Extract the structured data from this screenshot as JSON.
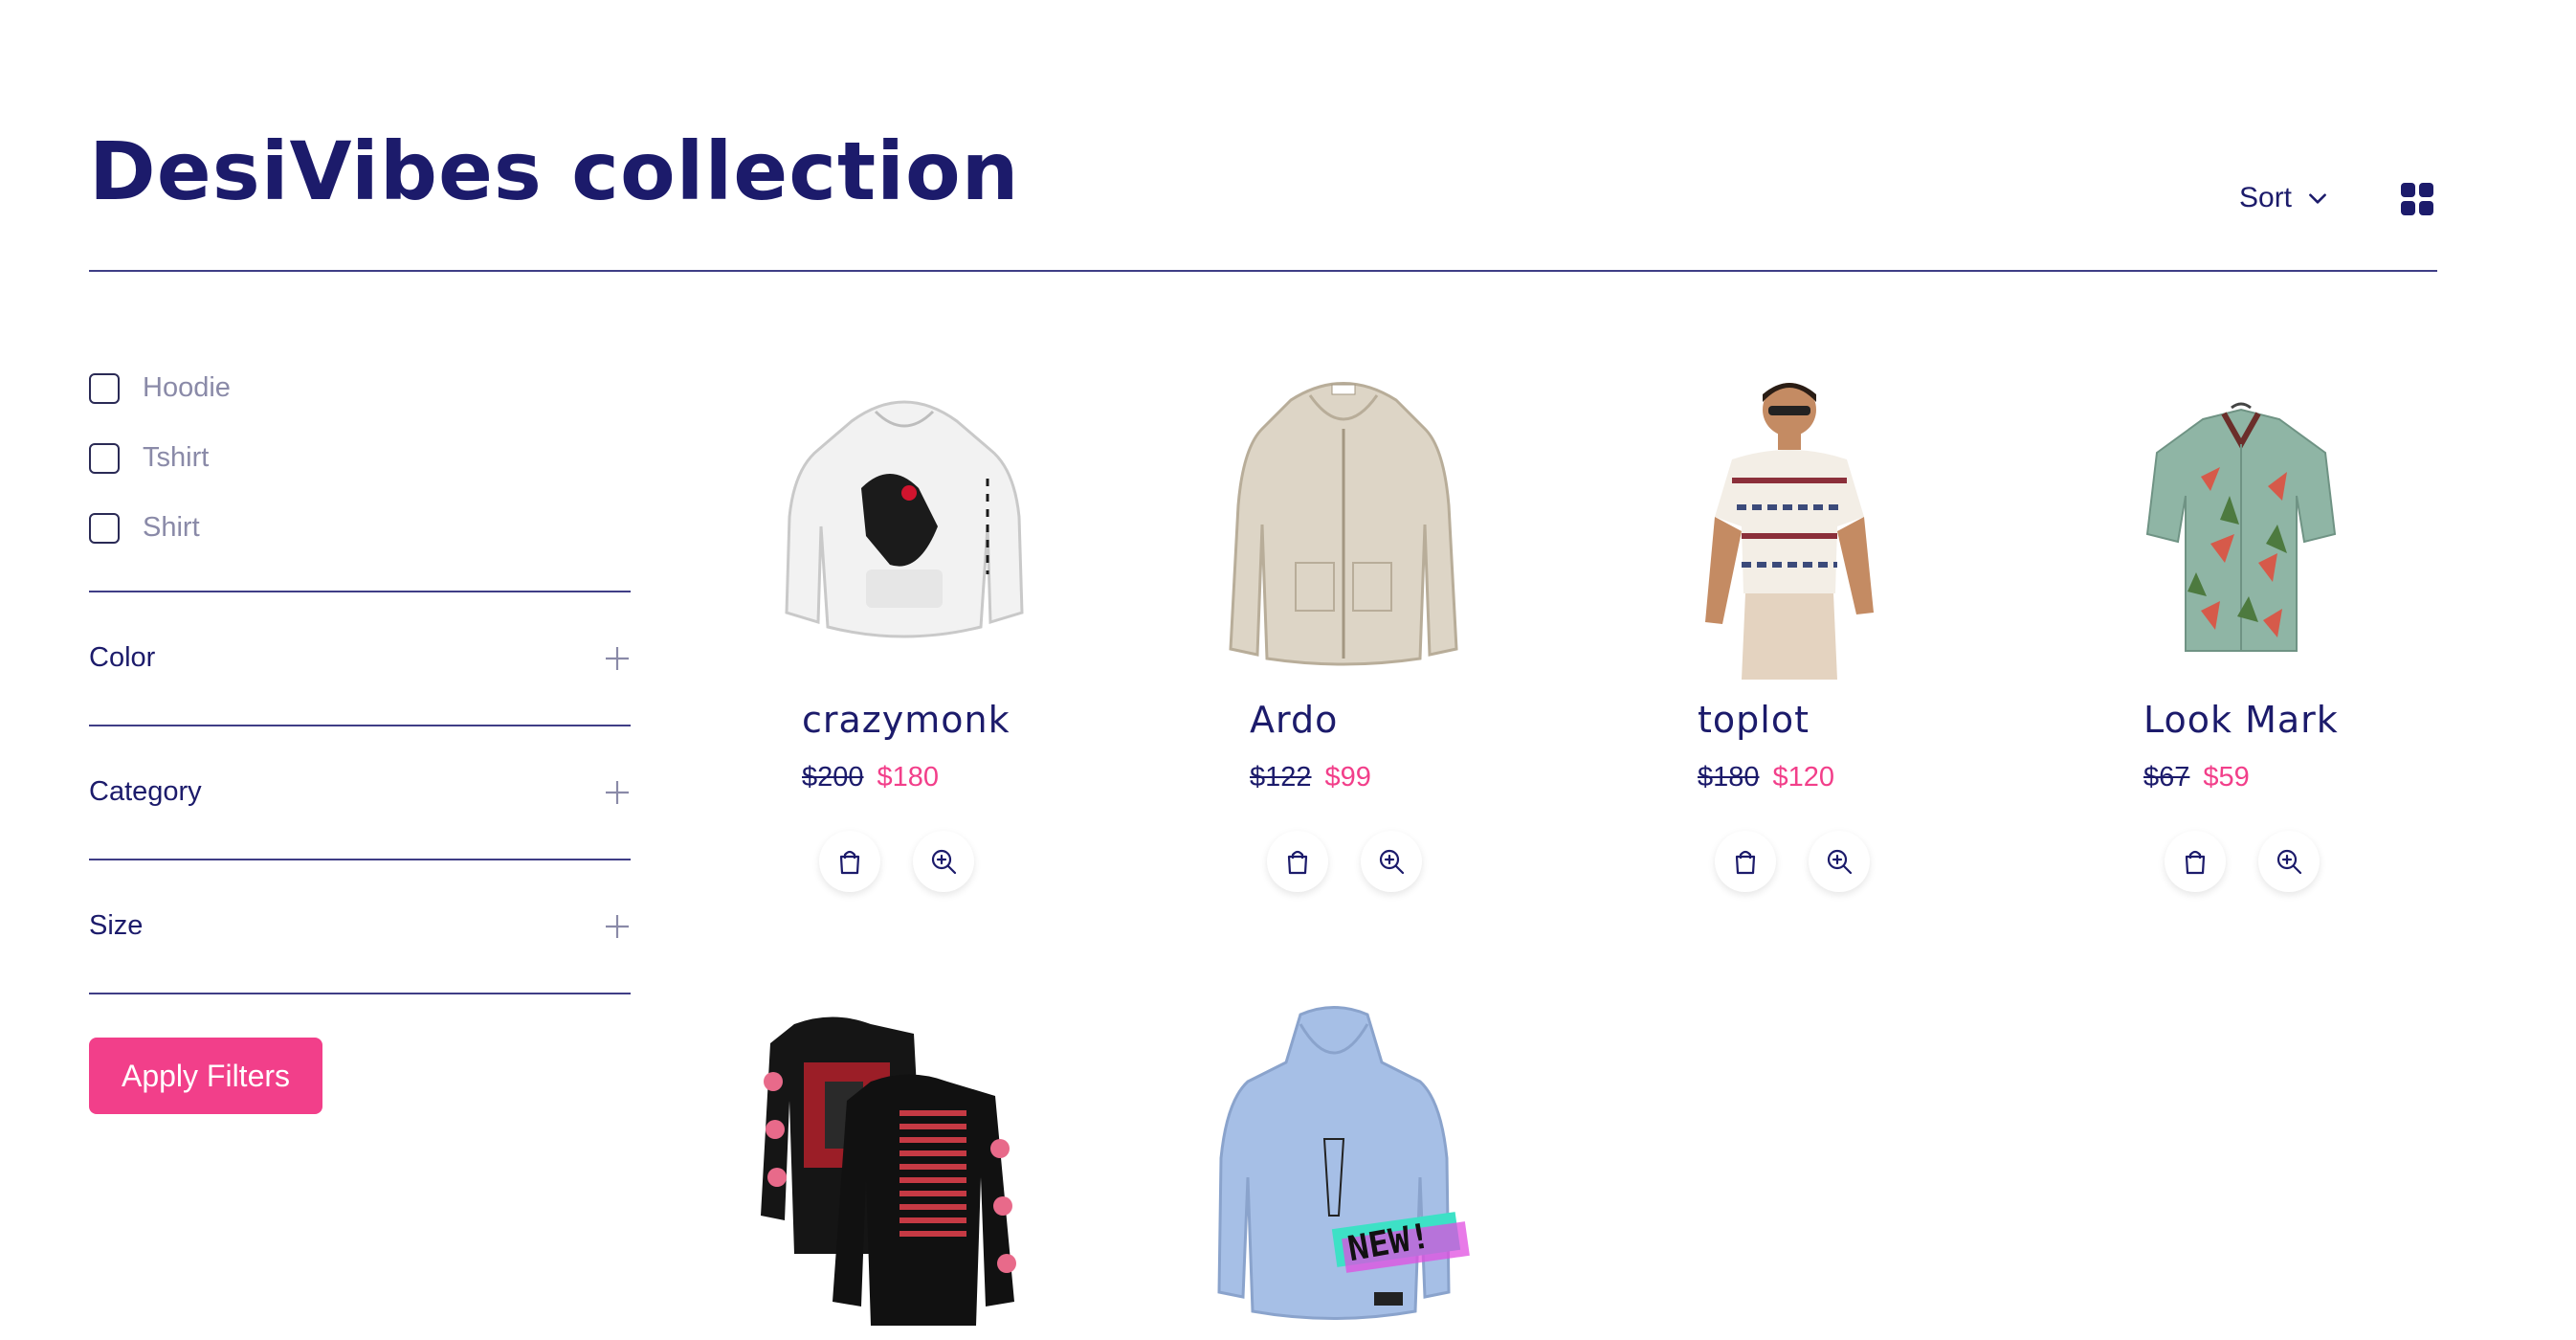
{
  "header": {
    "title": "DesiVibes collection",
    "sort_label": "Sort"
  },
  "filters": {
    "type_options": [
      {
        "label": "Hoodie",
        "checked": false
      },
      {
        "label": "Tshirt",
        "checked": false
      },
      {
        "label": "Shirt",
        "checked": false
      }
    ],
    "accordions": [
      {
        "label": "Color"
      },
      {
        "label": "Category"
      },
      {
        "label": "Size"
      }
    ],
    "apply_label": "Apply Filters"
  },
  "products": [
    {
      "name": "crazymonk",
      "old_price": "$200",
      "new_price": "$180",
      "image": "white-hoodie-image"
    },
    {
      "name": "Ardo",
      "old_price": "$122",
      "new_price": "$99",
      "image": "beige-zip-hoodie-image"
    },
    {
      "name": "toplot",
      "old_price": "$180",
      "new_price": "$120",
      "image": "striped-tshirt-model-image"
    },
    {
      "name": "Look Mark",
      "old_price": "$67",
      "new_price": "$59",
      "image": "floral-shirt-image"
    },
    {
      "image": "black-longsleeve-tees-image"
    },
    {
      "image": "blue-hoodie-new-image",
      "badge": "NEW!"
    }
  ],
  "colors": {
    "navy": "#1c1b6b",
    "accent": "#f23f8a",
    "muted": "#8a8aa8"
  },
  "icons": [
    "chevron-down-icon",
    "grid-view-icon",
    "plus-icon",
    "shopping-bag-icon",
    "zoom-in-icon"
  ]
}
